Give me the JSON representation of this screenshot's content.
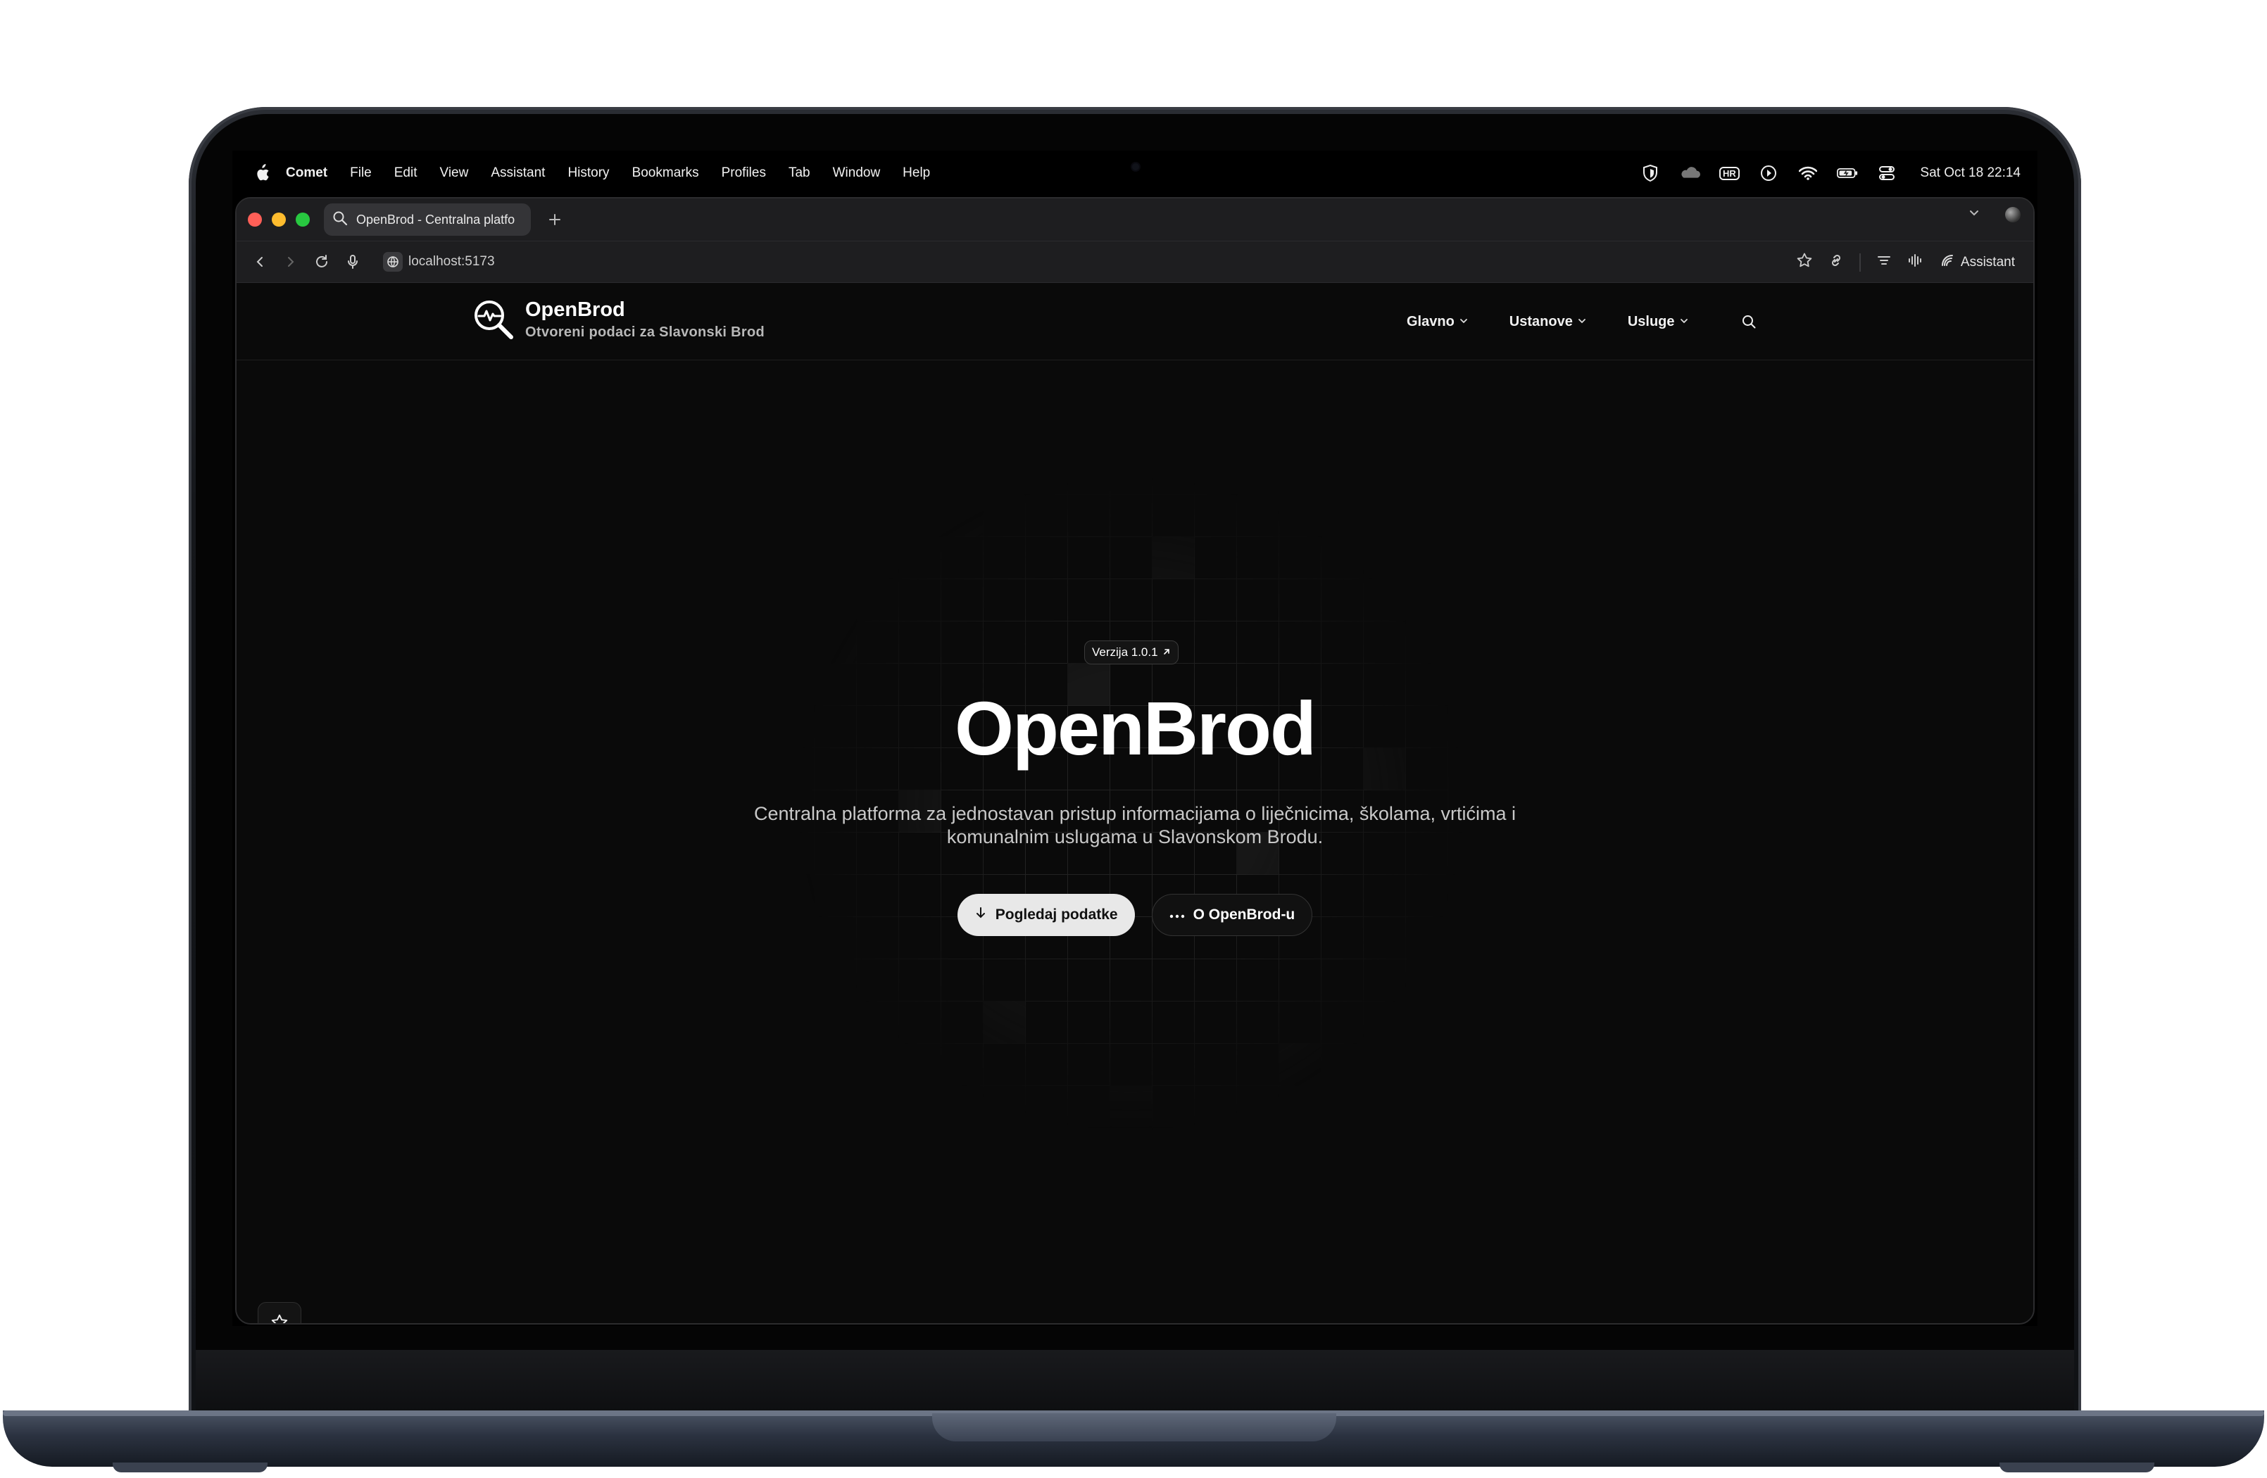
{
  "menubar": {
    "app_name": "Comet",
    "items": [
      "File",
      "Edit",
      "View",
      "Assistant",
      "History",
      "Bookmarks",
      "Profiles",
      "Tab",
      "Window",
      "Help"
    ],
    "input_source": "HR",
    "clock": "Sat Oct 18  22:14"
  },
  "browser": {
    "tab_title": "OpenBrod - Centralna platfo",
    "url": "localhost:5173",
    "assistant_label": "Assistant"
  },
  "site": {
    "brand_title": "OpenBrod",
    "brand_subtitle": "Otvoreni podaci za Slavonski Brod",
    "nav": [
      "Glavno",
      "Ustanove",
      "Usluge"
    ]
  },
  "hero": {
    "badge": "Verzija 1.0.1",
    "title": "OpenBrod",
    "subtitle_line1": "Centralna platforma za jednostavan pristup informacijama o liječnicima, školama, vrtićima i",
    "subtitle_line2": "komunalnim uslugama u Slavonskom Brodu.",
    "primary_button": "Pogledaj podatke",
    "secondary_button": "O OpenBrod-u"
  },
  "colors": {
    "background": "#0a0a0a",
    "accent_text": "#ffffff",
    "close": "#ff5f57",
    "minimize": "#febc2e",
    "zoom": "#28c840"
  }
}
